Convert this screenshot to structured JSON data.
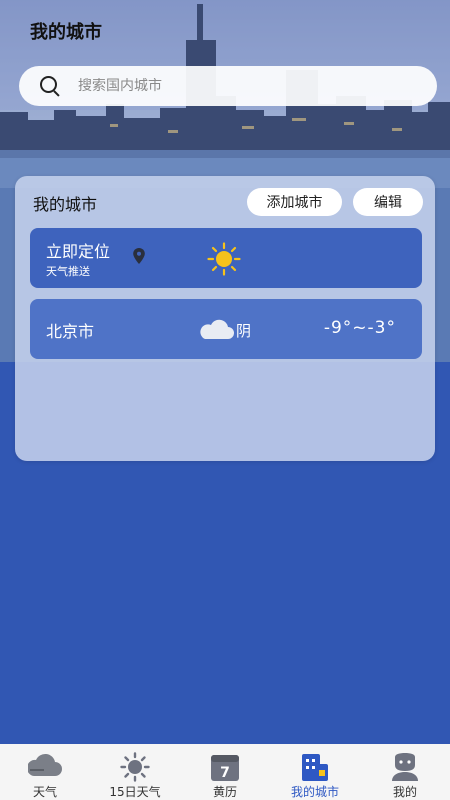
{
  "header": {
    "title": "我的城市"
  },
  "search": {
    "placeholder": "搜索国内城市",
    "icon": "search-icon"
  },
  "card": {
    "title": "我的城市",
    "add_button": "添加城市",
    "edit_button": "编辑",
    "rows": [
      {
        "name": "立即定位",
        "subtitle": "天气推送",
        "icon": "location-pin-icon",
        "weather_icon": "sun-icon"
      },
      {
        "name": "北京市",
        "weather_icon": "cloud-icon",
        "condition": "阴",
        "temp_range": "-9°~-3°"
      }
    ]
  },
  "tabbar": {
    "items": [
      {
        "label": "天气",
        "icon": "weather-cloud-icon"
      },
      {
        "label": "15日天气",
        "icon": "sun-icon"
      },
      {
        "label": "黄历",
        "icon": "calendar-icon",
        "badge": "7"
      },
      {
        "label": "我的城市",
        "icon": "city-building-icon",
        "active": true
      },
      {
        "label": "我的",
        "icon": "profile-icon"
      }
    ]
  },
  "colors": {
    "accent": "#2e58c3",
    "background": "#3157b3",
    "row_primary": "#3e63bd",
    "row_secondary": "#4f73c7",
    "sun": "#f6c21b"
  }
}
